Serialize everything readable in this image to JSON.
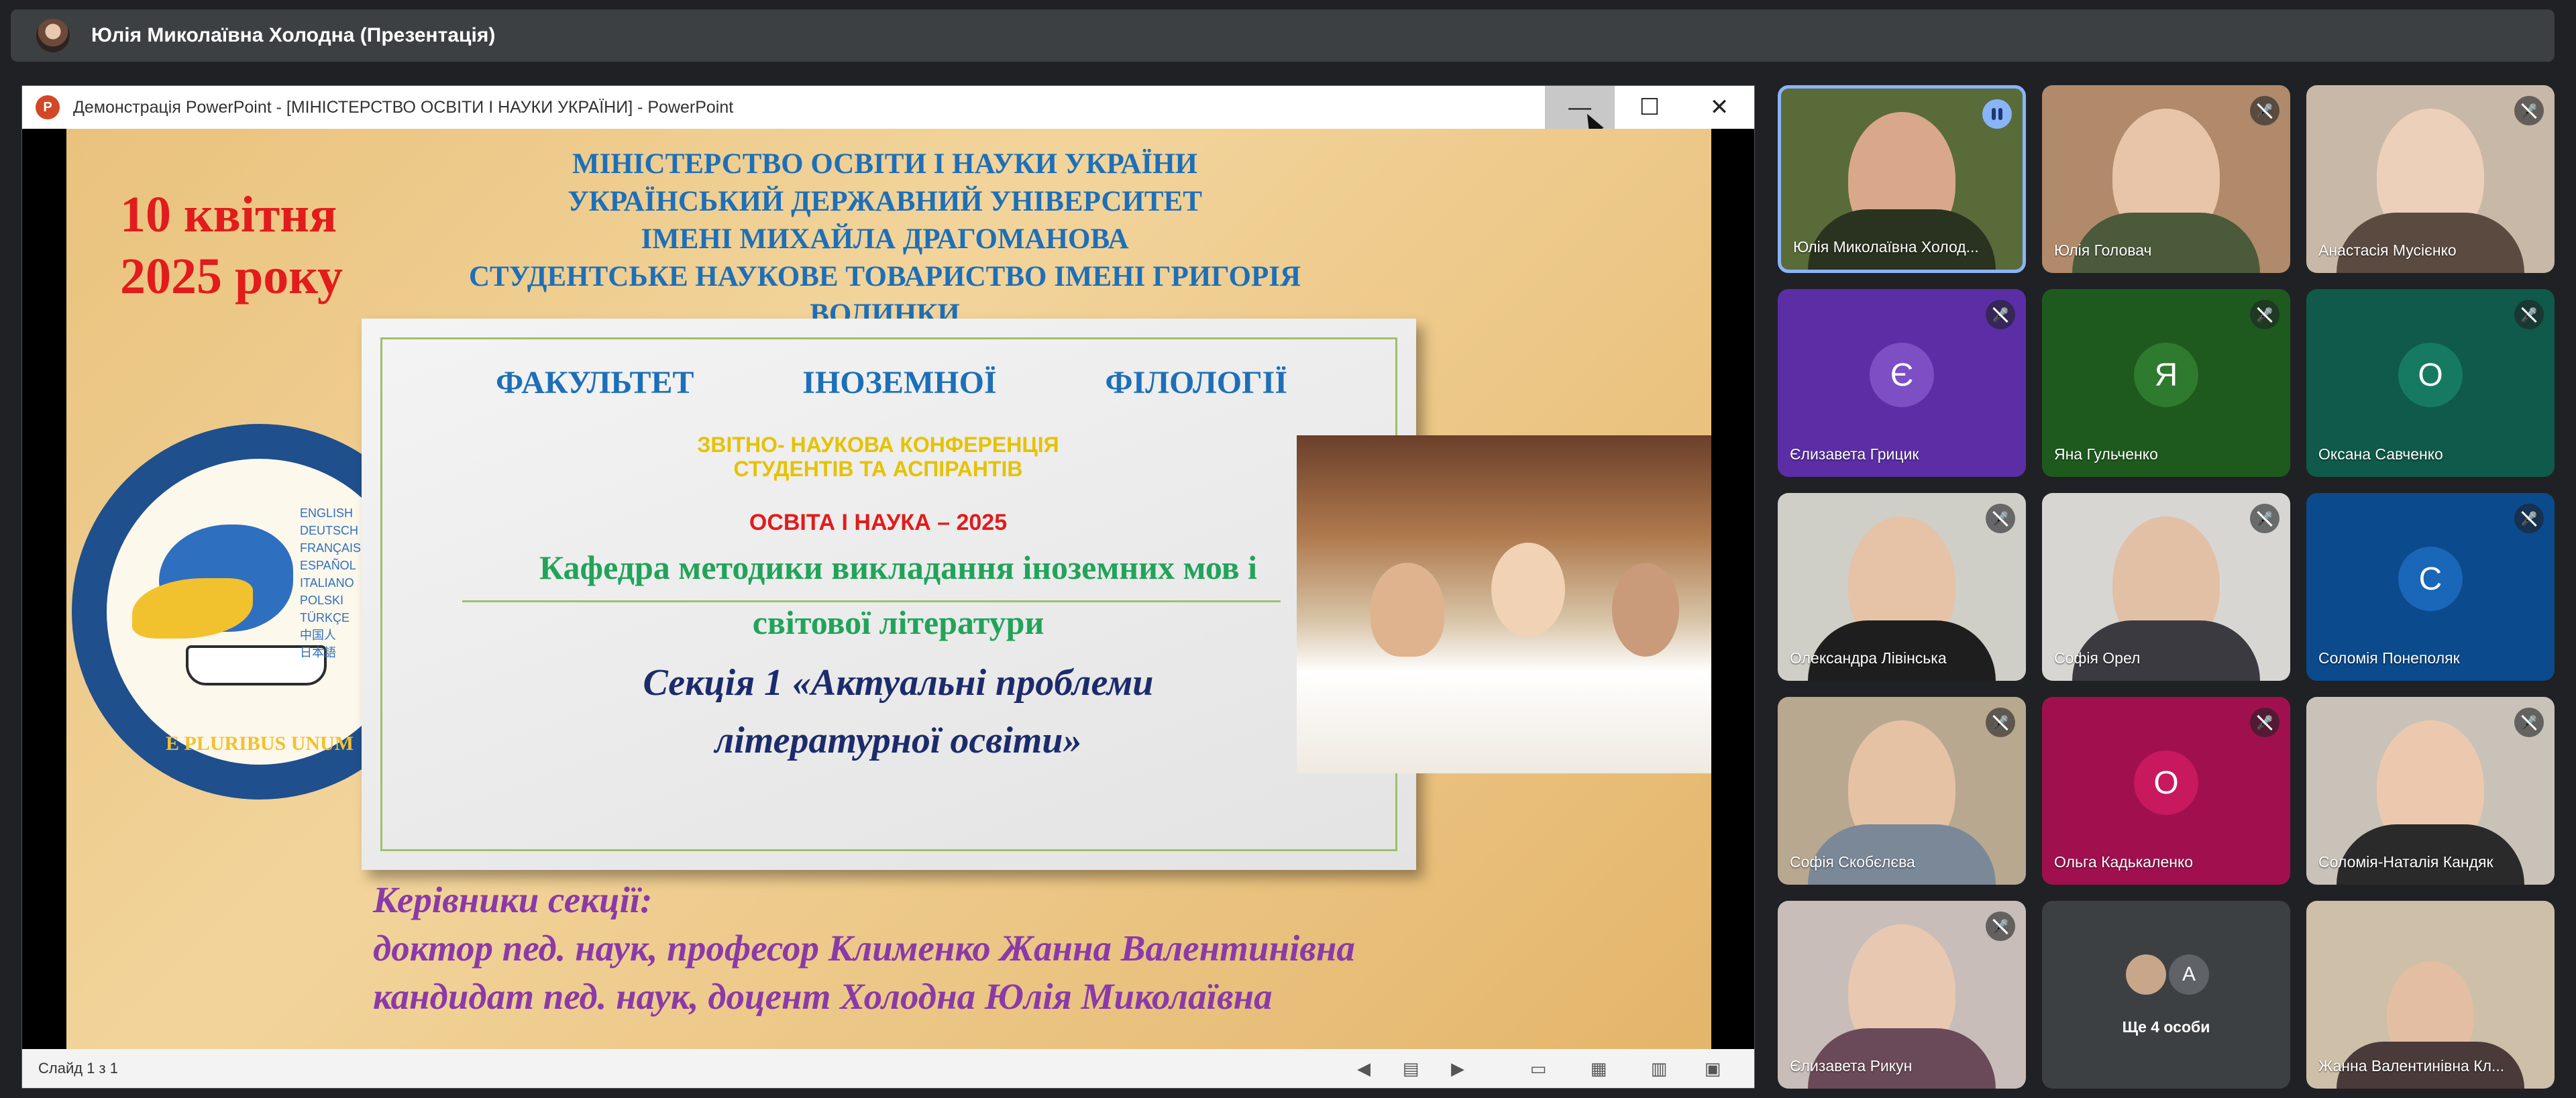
{
  "presenter_bar": {
    "title": "Юлія Миколаївна Холодна (Презентація)"
  },
  "ppt_window": {
    "title": "Демонстрація PowerPoint - [МІНІСТЕРСТВО ОСВІТИ І НАУКИ УКРАЇНИ] - PowerPoint",
    "app_icon_letter": "P",
    "minimize": "—",
    "maximize": "☐",
    "close": "✕",
    "status": "Слайд 1 з 1"
  },
  "slide": {
    "date_line1": "10 квітня",
    "date_line2": "2025 року",
    "ministry": [
      "МІНІСТЕРСТВО ОСВІТИ І НАУКИ УКРАЇНИ",
      "УКРАЇНСЬКИЙ ДЕРЖАВНИЙ УНІВЕРСИТЕТ",
      "ІМЕНІ МИХАЙЛА ДРАГОМАНОВА",
      "СТУДЕНТСЬКЕ НАУКОВЕ ТОВАРИСТВО ІМЕНІ ГРИГОРІЯ",
      "ВОЛИНКИ"
    ],
    "faculty": [
      "ФАКУЛЬТЕТ",
      "ІНОЗЕМНОЇ",
      "ФІЛОЛОГІЇ"
    ],
    "conference_line1": "ЗВІТНО- НАУКОВА КОНФЕРЕНЦІЯ",
    "conference_line2": "СТУДЕНТІВ ТА АСПІРАНТІВ",
    "osvita": "ОСВІТА І НАУКА – 2025",
    "kafedra_line1": "Кафедра методики викладання іноземних мов і",
    "kafedra_line2": "світової літератури",
    "section_line1": "Секція 1   «Актуальні проблеми",
    "section_line2": "літературної освіти»",
    "leaders_title": "Керівники секції:",
    "leader1": "доктор пед. наук, професор Клименко Жанна Валентинівна",
    "leader2": "кандидат пед. наук, доцент Холодна Юлія Миколаївна",
    "logo_banner": "E PLURIBUS UNUM",
    "logo_langs": [
      "ENGLISH",
      "DEUTSCH",
      "FRANÇAIS",
      "ESPAÑOL",
      "ITALIANO",
      "POLSKI",
      "TÜRKÇE",
      "中国人",
      "日本語"
    ]
  },
  "participants": [
    {
      "name": "Юлія Миколаївна Холод...",
      "initial": "",
      "speaking": true
    },
    {
      "name": "Юлія Головач",
      "initial": ""
    },
    {
      "name": "Анастасія Мусієнко",
      "initial": ""
    },
    {
      "name": "Єлизавета Грицик",
      "initial": "Є"
    },
    {
      "name": "Яна Гульченко",
      "initial": "Я"
    },
    {
      "name": "Оксана Савченко",
      "initial": "О"
    },
    {
      "name": "Олександра Лівінська",
      "initial": ""
    },
    {
      "name": "Софія Орел",
      "initial": ""
    },
    {
      "name": "Соломія Понеполяк",
      "initial": "С"
    },
    {
      "name": "Софія Скобєлєва",
      "initial": ""
    },
    {
      "name": "Ольга Кадькаленко",
      "initial": "О"
    },
    {
      "name": "Соломія-Наталія Кандяк",
      "initial": ""
    },
    {
      "name": "Єлизавета Рикун",
      "initial": ""
    },
    {
      "name": "Ще 4 особи",
      "initial": "А"
    },
    {
      "name": "Жанна Валентинівна Кл...",
      "initial": ""
    }
  ],
  "colors": {
    "background": "#202124",
    "active_speaker": "#8ab4f8",
    "tile_purple": "#5b2ea6",
    "tile_green_dark": "#1e5a1e",
    "tile_teal": "#0f5a4a",
    "tile_navy": "#0b4a8c",
    "tile_magenta": "#a0104e"
  }
}
